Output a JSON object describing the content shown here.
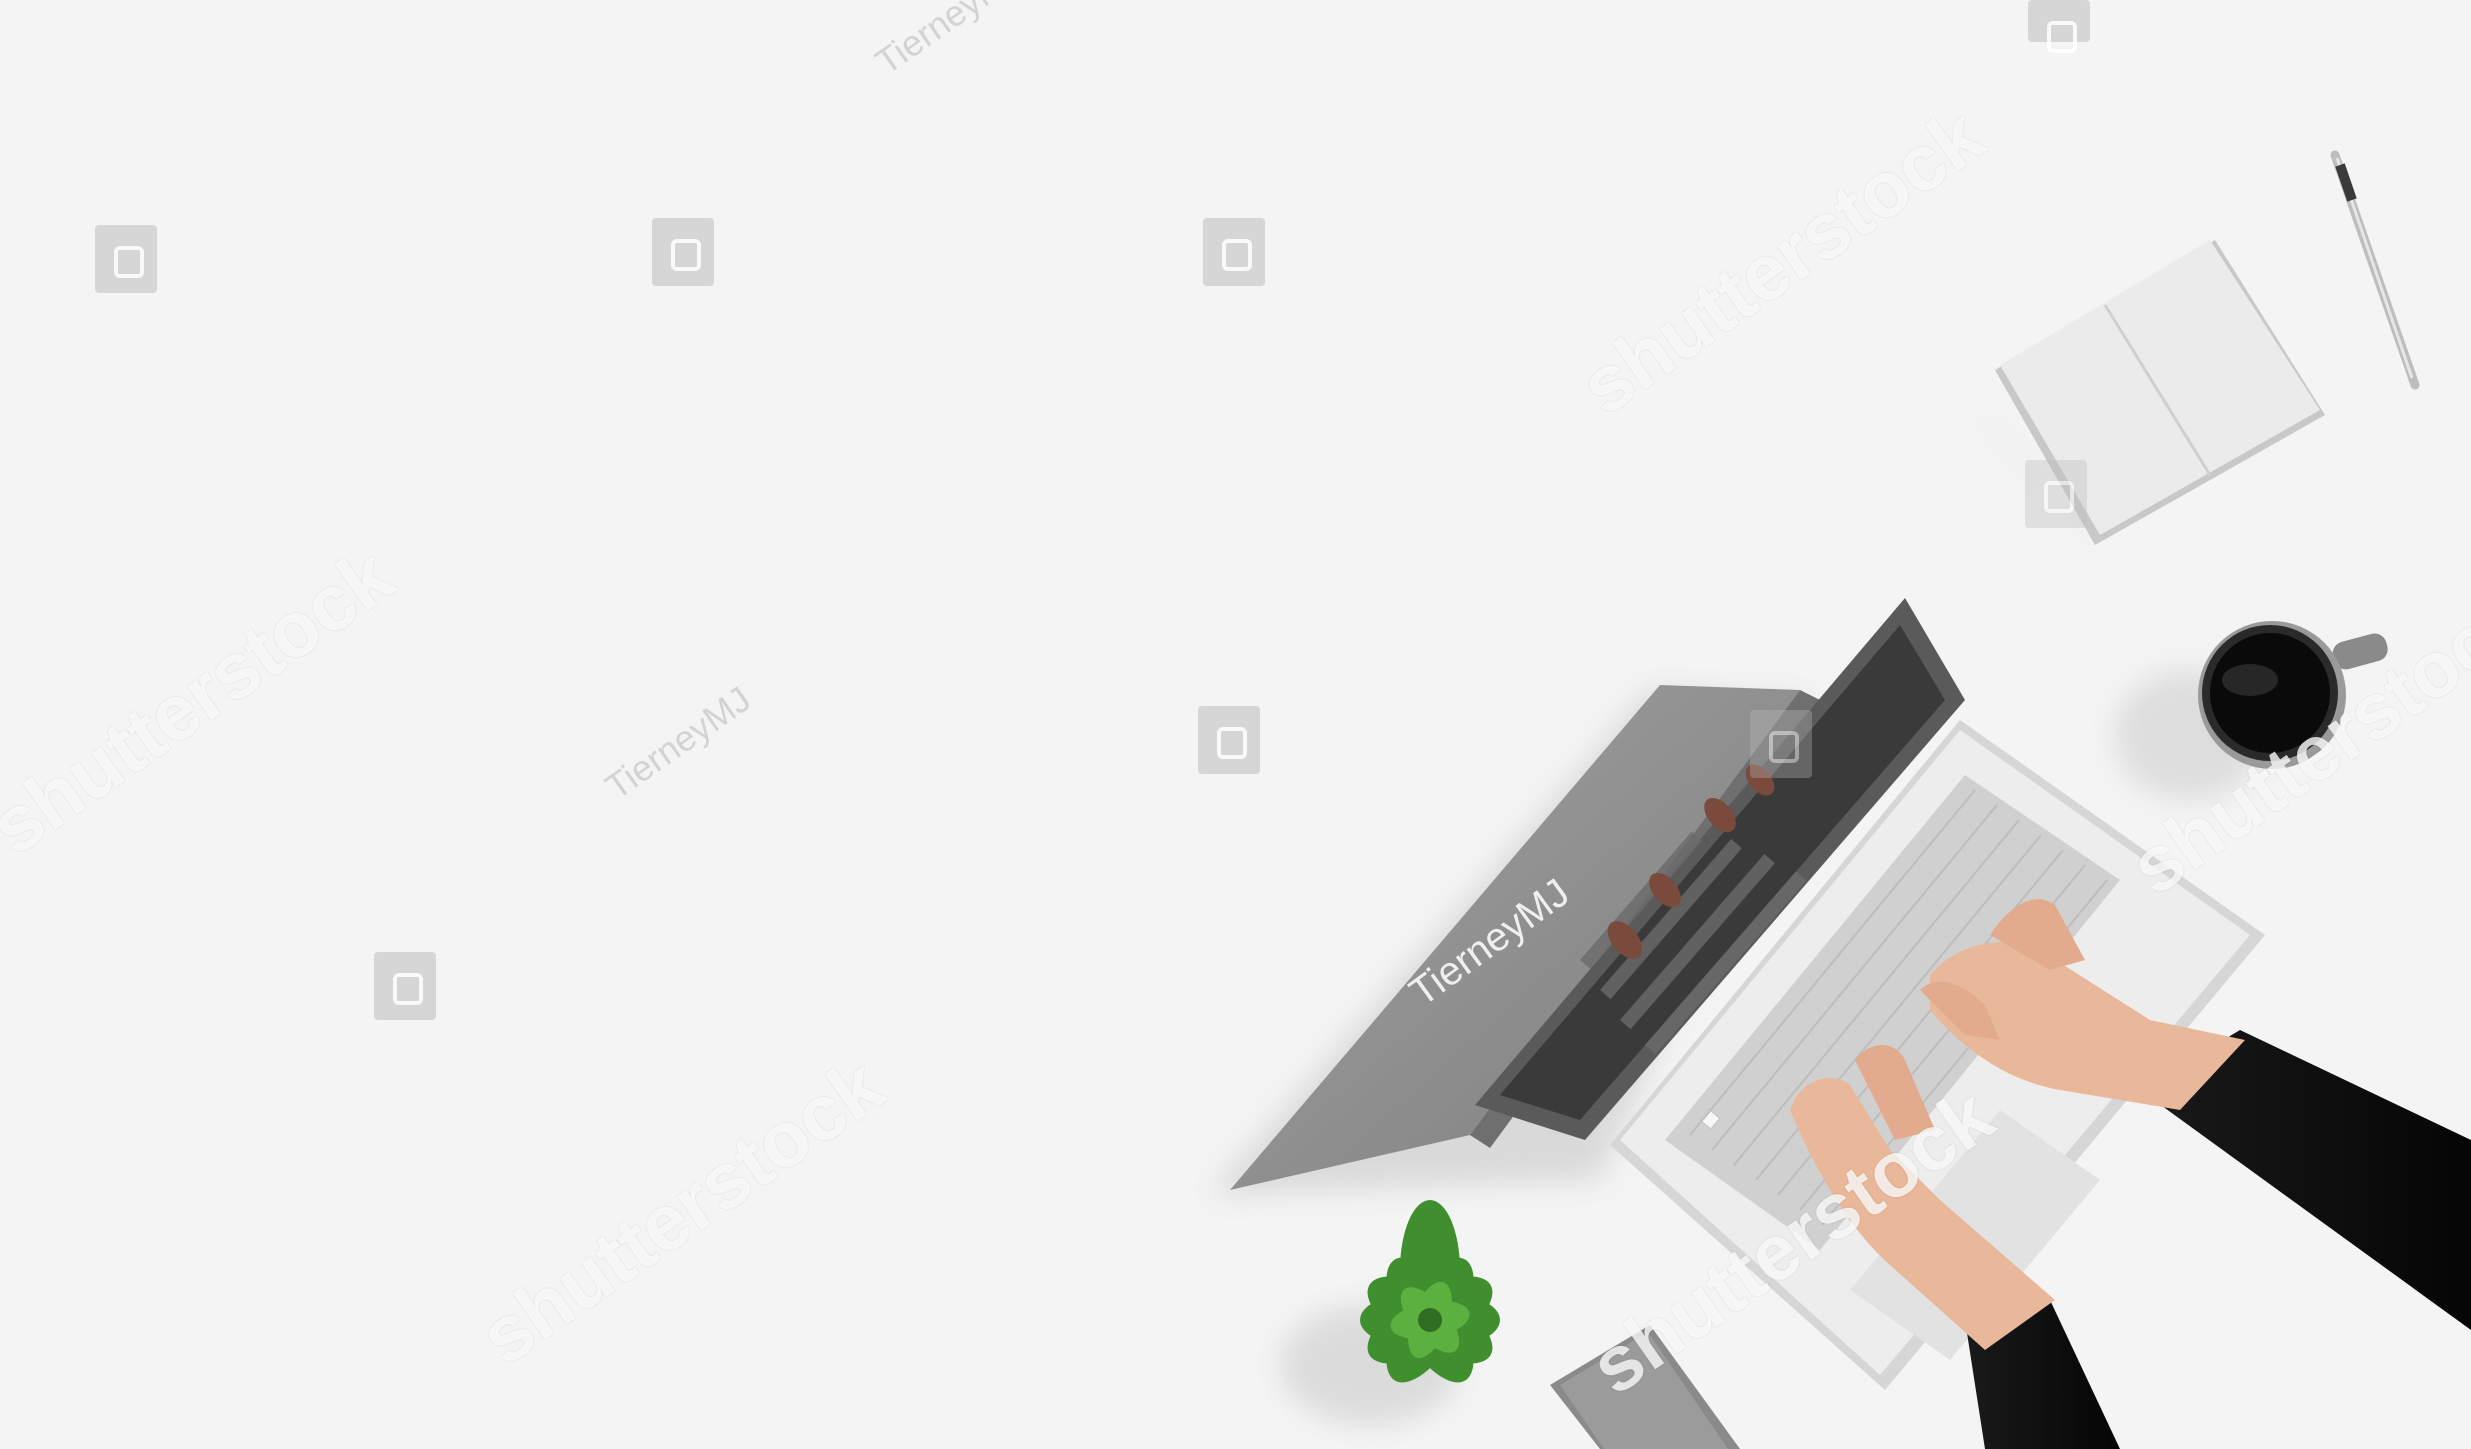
{
  "image": {
    "kind": "photo",
    "scene": "overhead-desk-with-laptop",
    "watermark_brand": "shutterstock",
    "laptop_lid_text": "TierneyMJ",
    "watermark_author": "TierneyMJ",
    "colors": {
      "background": "#f4f4f4",
      "laptop_lid": "#8f8f8f",
      "keyboard_base": "#e8e8e8",
      "sleeve": "#111111",
      "skin": "#e9b79a",
      "plant": "#3f8f2f",
      "coffee": "#0a0a0a"
    }
  }
}
